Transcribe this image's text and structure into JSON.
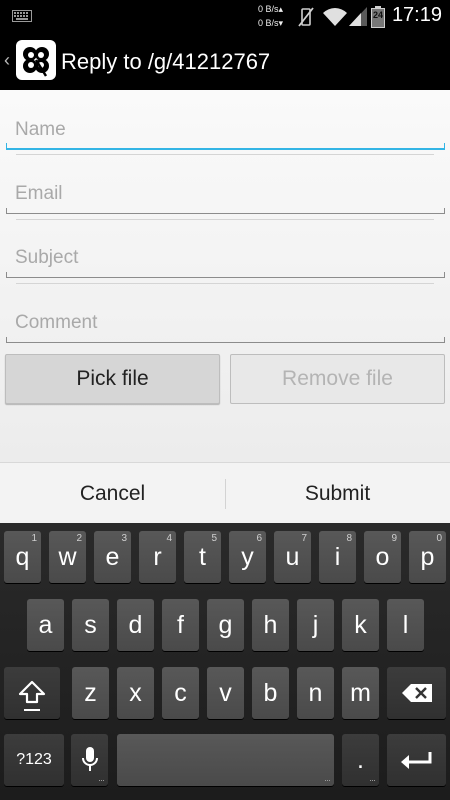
{
  "status_bar": {
    "netspeed_up": "0 B/s",
    "netspeed_down": "0 B/s",
    "time": "17:19",
    "battery": "24",
    "icons": [
      "keyboard-icon",
      "vibrate-off-icon",
      "wifi-icon",
      "signal-icon",
      "battery-icon"
    ]
  },
  "action_bar": {
    "title": "Reply to /g/41212767",
    "icons": [
      "back-chevron-icon",
      "clover-logo-icon"
    ]
  },
  "form": {
    "name_placeholder": "Name",
    "email_placeholder": "Email",
    "subject_placeholder": "Subject",
    "comment_placeholder": "Comment",
    "pick_file_label": "Pick file",
    "remove_file_label": "Remove file"
  },
  "dialog": {
    "cancel_label": "Cancel",
    "submit_label": "Submit"
  },
  "keyboard": {
    "row1": [
      {
        "key": "q",
        "hint": "1"
      },
      {
        "key": "w",
        "hint": "2"
      },
      {
        "key": "e",
        "hint": "3"
      },
      {
        "key": "r",
        "hint": "4"
      },
      {
        "key": "t",
        "hint": "5"
      },
      {
        "key": "y",
        "hint": "6"
      },
      {
        "key": "u",
        "hint": "7"
      },
      {
        "key": "i",
        "hint": "8"
      },
      {
        "key": "o",
        "hint": "9"
      },
      {
        "key": "p",
        "hint": "0"
      }
    ],
    "row2": [
      "a",
      "s",
      "d",
      "f",
      "g",
      "h",
      "j",
      "k",
      "l"
    ],
    "row3": [
      "z",
      "x",
      "c",
      "v",
      "b",
      "n",
      "m"
    ],
    "symbols_label": "?123",
    "period_label": ".",
    "icons": [
      "shift-icon",
      "backspace-icon",
      "microphone-icon",
      "enter-icon"
    ],
    "accent_color": "#33b5e5"
  }
}
